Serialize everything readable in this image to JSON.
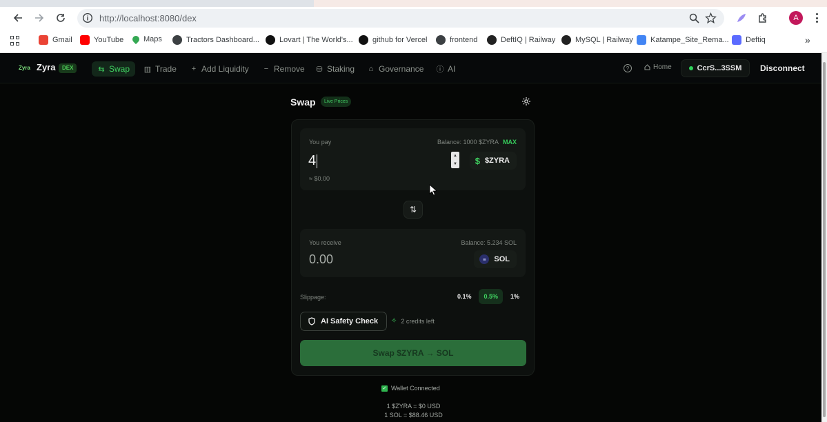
{
  "browser": {
    "url": "http://localhost:8080/dex",
    "profile_initial": "A",
    "bookmarks": [
      {
        "label": "Gmail",
        "icon": "gmail-icon",
        "color": "#ea4335"
      },
      {
        "label": "YouTube",
        "icon": "youtube-icon",
        "color": "#ff0000"
      },
      {
        "label": "Maps",
        "icon": "maps-icon",
        "color": "#34a853"
      },
      {
        "label": "Tractors Dashboard...",
        "icon": "globe-icon",
        "color": "#3c4043"
      },
      {
        "label": "Lovart | The World's...",
        "icon": "lovart-icon",
        "color": "#111111"
      },
      {
        "label": "github for Vercel",
        "icon": "vercel-icon",
        "color": "#111111"
      },
      {
        "label": "frontend",
        "icon": "globe-icon",
        "color": "#3c4043"
      },
      {
        "label": "DeftIQ | Railway",
        "icon": "railway-icon",
        "color": "#222222"
      },
      {
        "label": "MySQL | Railway",
        "icon": "railway-icon",
        "color": "#222222"
      },
      {
        "label": "Katampe_Site_Rema...",
        "icon": "docs-icon",
        "color": "#4285f4"
      },
      {
        "label": "Deftiq",
        "icon": "deftiq-icon",
        "color": "#5b6bff"
      }
    ],
    "more_bookmarks": "»"
  },
  "app": {
    "logo_mark": "Zyra",
    "logo_text": "Zyra",
    "logo_badge": "DEX",
    "nav": [
      {
        "label": "Swap",
        "icon": "swap-icon",
        "active": true
      },
      {
        "label": "Trade",
        "icon": "chart-icon",
        "active": false
      },
      {
        "label": "Add Liquidity",
        "icon": "plus-icon",
        "active": false
      },
      {
        "label": "Remove",
        "icon": "minus-icon",
        "active": false
      },
      {
        "label": "Staking",
        "icon": "staking-icon",
        "active": false
      },
      {
        "label": "Governance",
        "icon": "governance-icon",
        "active": false
      },
      {
        "label": "AI",
        "icon": "ai-icon",
        "active": false
      }
    ],
    "help_glyph": "?",
    "home_label": "Home",
    "wallet_address": "CcrS...3SSM",
    "disconnect_label": "Disconnect"
  },
  "swap": {
    "title": "Swap",
    "live_badge": "Live Prices",
    "pay": {
      "label": "You pay",
      "balance": "Balance: 1000 $ZYRA",
      "max_label": "MAX",
      "amount": "4",
      "usd": "≈ $0.00",
      "token_symbol": "$ZYRA",
      "token_glyph": "$"
    },
    "receive": {
      "label": "You receive",
      "balance": "Balance: 5.234 SOL",
      "amount": "0.00",
      "token_symbol": "SOL",
      "token_glyph": "≡"
    },
    "flip_glyph": "⇅",
    "slippage_label": "Slippage:",
    "slippage_options": [
      {
        "label": "0.1%",
        "active": false
      },
      {
        "label": "0.5%",
        "active": true
      },
      {
        "label": "1%",
        "active": false
      }
    ],
    "ai_check_label": "AI Safety Check",
    "credits_text": "2 credits left",
    "swap_button_label": "Swap $ZYRA → SOL"
  },
  "footer": {
    "wallet_status": "Wallet Connected",
    "rate_zyra": "1 $ZYRA = $0 USD",
    "rate_sol": "1 SOL = $88.46 USD"
  },
  "colors": {
    "accent": "#3fd260",
    "background": "#050605",
    "card": "#0d100e",
    "swap_button": "#2b6e3a"
  }
}
